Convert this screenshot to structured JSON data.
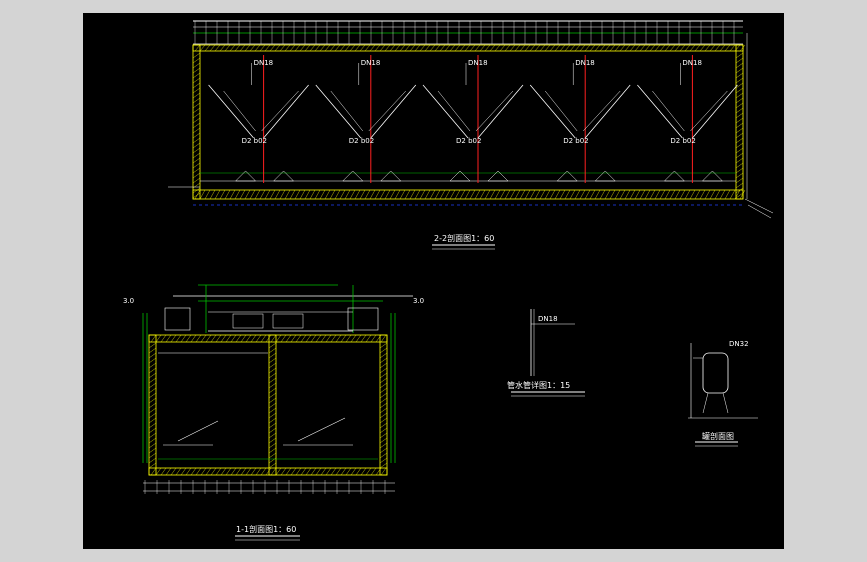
{
  "drawing": {
    "background": "#000000",
    "frame_color": "#d4d4d4",
    "colors": {
      "wall": "#ffff00",
      "line": "#ffffff",
      "green": "#00c000",
      "red": "#ff2020",
      "cyan": "#00c8ff",
      "blue": "#2040ff"
    }
  },
  "section_2_2": {
    "title": "2-2剖面图1：60",
    "pipe_label": "DN18",
    "hopper_label": "D2 b02",
    "hoppers": 5
  },
  "section_1_1": {
    "title": "1-1剖面图1：60",
    "level_left": "3.0",
    "level_right": "3.0"
  },
  "pipe_detail": {
    "title": "管水管详图1：15",
    "label": "DN18"
  },
  "tank_detail": {
    "title": "罐剖面图",
    "label": "DN32"
  }
}
